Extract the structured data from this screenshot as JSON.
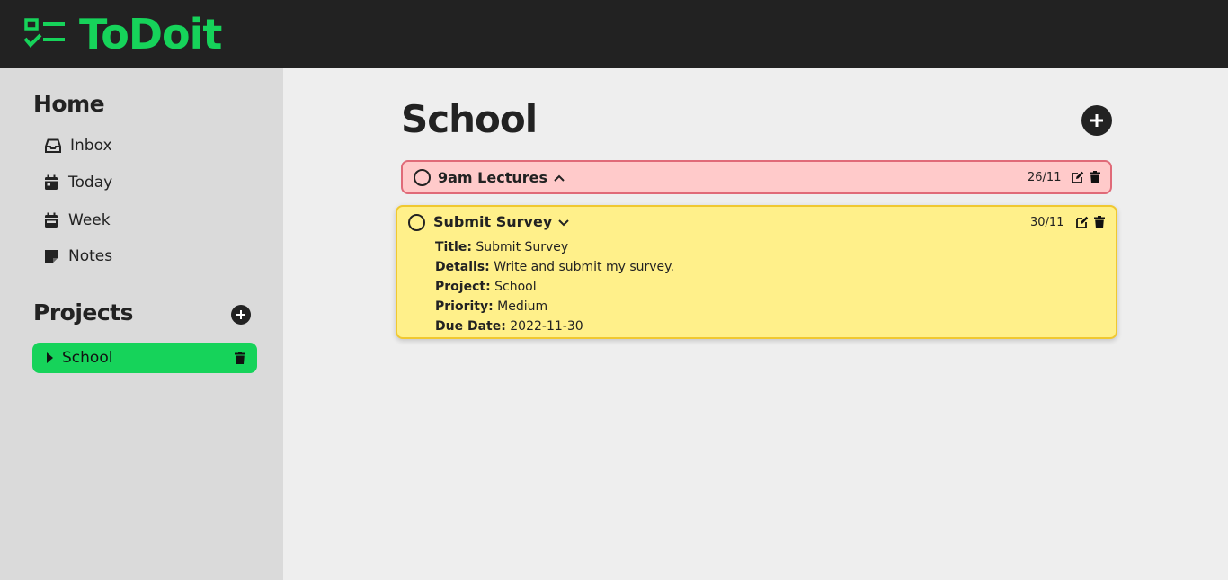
{
  "app": {
    "name": "ToDoit"
  },
  "sidebar": {
    "home_heading": "Home",
    "home_items": [
      {
        "label": "Inbox",
        "icon": "inbox-icon"
      },
      {
        "label": "Today",
        "icon": "calendar-day-icon"
      },
      {
        "label": "Week",
        "icon": "calendar-week-icon"
      },
      {
        "label": "Notes",
        "icon": "sticky-note-icon"
      }
    ],
    "projects_heading": "Projects",
    "projects": [
      {
        "label": "School"
      }
    ]
  },
  "main": {
    "title": "School",
    "tasks": [
      {
        "name": "9am Lectures",
        "date": "26/11",
        "color": "#ffcaca",
        "expanded": false
      },
      {
        "name": "Submit Survey",
        "date": "30/11",
        "color": "#fff08a",
        "expanded": true,
        "details": {
          "title_label": "Title:",
          "title_value": "Submit Survey",
          "details_label": "Details:",
          "details_value": "Write and submit my survey.",
          "project_label": "Project:",
          "project_value": "School",
          "priority_label": "Priority:",
          "priority_value": "Medium",
          "due_label": "Due Date:",
          "due_value": "2022-11-30"
        }
      }
    ]
  },
  "colors": {
    "brand": "#16d35a",
    "header_bg": "#222222",
    "sidebar_bg": "#dadada"
  }
}
